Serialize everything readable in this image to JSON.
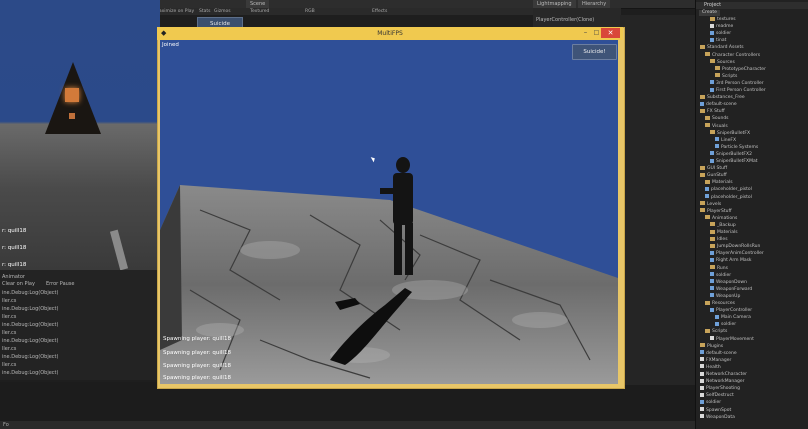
{
  "editor": {
    "tabs": {
      "scene": "Scene",
      "lightmapping": "Lightmapping",
      "hierarchy": "Hierarchy",
      "project": "Project"
    },
    "toolbar": {
      "maximize": "Maximize on Play",
      "stats": "Stats",
      "gizmos": "Gizmos",
      "textured": "Textured",
      "rgb": "RGB",
      "effects": "Effects"
    },
    "hierarchy_item": "PlayerController(Clone)",
    "status_text": "Fo",
    "left_log": {
      "overlay": [
        "r: quill18",
        "r: quill18",
        "r: quill18"
      ],
      "console_header": [
        "Animator",
        "Clear on Play",
        "Error Pause"
      ],
      "lines": [
        "ine.Debug:Log(Object)",
        "ller.cs",
        "ine.Debug:Log(Object)",
        "ller.cs",
        "ine.Debug:Log(Object)",
        "ller.cs",
        "ine.Debug:Log(Object)",
        "ller.cs",
        "ine.Debug:Log(Object)",
        "ller.cs",
        "ine.Debug:Log(Object)"
      ]
    }
  },
  "project_panel": {
    "title": "Project",
    "create": "Create",
    "items": [
      {
        "label": "textures",
        "kind": "folder",
        "indent": 2
      },
      {
        "label": "readme",
        "kind": "script",
        "indent": 2
      },
      {
        "label": "soldier",
        "kind": "asset",
        "indent": 2
      },
      {
        "label": "tinat",
        "kind": "asset",
        "indent": 2
      },
      {
        "label": "Standard Assets",
        "kind": "folder",
        "indent": 0
      },
      {
        "label": "Character Controllers",
        "kind": "folder",
        "indent": 1
      },
      {
        "label": "Sources",
        "kind": "folder",
        "indent": 2
      },
      {
        "label": "PrototypeCharacter",
        "kind": "folder",
        "indent": 3
      },
      {
        "label": "Scripts",
        "kind": "folder",
        "indent": 3
      },
      {
        "label": "3rd Person Controller",
        "kind": "asset",
        "indent": 2
      },
      {
        "label": "First Person Controller",
        "kind": "asset",
        "indent": 2
      },
      {
        "label": "Substances_Free",
        "kind": "folder",
        "indent": 0
      },
      {
        "label": "default-scene",
        "kind": "asset",
        "indent": 0
      },
      {
        "label": "FX Stuff",
        "kind": "folder",
        "indent": 0
      },
      {
        "label": "Sounds",
        "kind": "folder",
        "indent": 1
      },
      {
        "label": "Visuals",
        "kind": "folder",
        "indent": 1
      },
      {
        "label": "SniperBulletFX",
        "kind": "folder",
        "indent": 2
      },
      {
        "label": "LineFX",
        "kind": "asset",
        "indent": 3
      },
      {
        "label": "Particle Systems",
        "kind": "asset",
        "indent": 3
      },
      {
        "label": "SniperBulletFX2",
        "kind": "asset",
        "indent": 2
      },
      {
        "label": "SniperBulletFXMat",
        "kind": "asset",
        "indent": 2
      },
      {
        "label": "GUI Stuff",
        "kind": "folder",
        "indent": 0
      },
      {
        "label": "GunStuff",
        "kind": "folder",
        "indent": 0
      },
      {
        "label": "Materials",
        "kind": "folder",
        "indent": 1
      },
      {
        "label": "placeholder_pistol",
        "kind": "asset",
        "indent": 1
      },
      {
        "label": "placeholder_pistol",
        "kind": "asset",
        "indent": 1
      },
      {
        "label": "Levels",
        "kind": "folder",
        "indent": 0
      },
      {
        "label": "PlayerStuff",
        "kind": "folder",
        "indent": 0
      },
      {
        "label": "Animations",
        "kind": "folder",
        "indent": 1
      },
      {
        "label": "_Backup",
        "kind": "folder",
        "indent": 2
      },
      {
        "label": "Materials",
        "kind": "folder",
        "indent": 2
      },
      {
        "label": "Idles",
        "kind": "folder",
        "indent": 2
      },
      {
        "label": "JumpDownRollsRun",
        "kind": "folder",
        "indent": 2
      },
      {
        "label": "PlayerAnimController",
        "kind": "asset",
        "indent": 2
      },
      {
        "label": "Right Arm Mask",
        "kind": "asset",
        "indent": 2
      },
      {
        "label": "Runs",
        "kind": "folder",
        "indent": 2
      },
      {
        "label": "soldier",
        "kind": "asset",
        "indent": 2
      },
      {
        "label": "WeaponDown",
        "kind": "asset",
        "indent": 2
      },
      {
        "label": "WeaponForward",
        "kind": "asset",
        "indent": 2
      },
      {
        "label": "WeaponUp",
        "kind": "asset",
        "indent": 2
      },
      {
        "label": "Resources",
        "kind": "folder",
        "indent": 1
      },
      {
        "label": "PlayerController",
        "kind": "asset",
        "indent": 2
      },
      {
        "label": "Main Camera",
        "kind": "asset",
        "indent": 3
      },
      {
        "label": "soldier",
        "kind": "asset",
        "indent": 3
      },
      {
        "label": "Scripts",
        "kind": "folder",
        "indent": 1
      },
      {
        "label": "PlayerMovement",
        "kind": "script",
        "indent": 2
      },
      {
        "label": "Plugins",
        "kind": "folder",
        "indent": 0
      },
      {
        "label": "default-scene",
        "kind": "asset",
        "indent": 0
      },
      {
        "label": "FXManager",
        "kind": "script",
        "indent": 0
      },
      {
        "label": "Health",
        "kind": "script",
        "indent": 0
      },
      {
        "label": "NetworkCharacter",
        "kind": "script",
        "indent": 0
      },
      {
        "label": "NetworkManager",
        "kind": "script",
        "indent": 0
      },
      {
        "label": "PlayerShooting",
        "kind": "script",
        "indent": 0
      },
      {
        "label": "SelfDestruct",
        "kind": "script",
        "indent": 0
      },
      {
        "label": "soldier",
        "kind": "asset",
        "indent": 0
      },
      {
        "label": "SpawnSpot",
        "kind": "script",
        "indent": 0
      },
      {
        "label": "WeaponData",
        "kind": "script",
        "indent": 0
      }
    ]
  },
  "game_window": {
    "title": "MultiFPS",
    "joined": "Joined",
    "suicide": "Suicide!",
    "suicide_bg": "Suicide",
    "log": [
      "Spawning player: quill18",
      "Spawning player: quill18",
      "Spawning player: quill18",
      "Spawning player: quill18"
    ],
    "colors": {
      "frame": "#f0c94f",
      "sky": "#2f4f97",
      "close": "#d9473a"
    }
  }
}
